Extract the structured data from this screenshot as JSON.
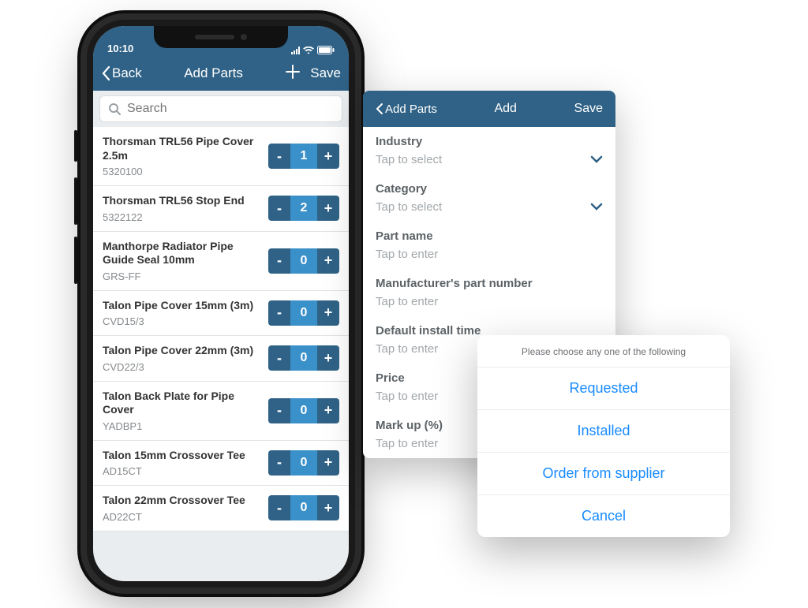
{
  "phone": {
    "status": {
      "time": "10:10"
    },
    "nav": {
      "back": "Back",
      "title": "Add Parts",
      "save": "Save"
    },
    "search": {
      "placeholder": "Search"
    },
    "parts": [
      {
        "name": "Thorsman TRL56 Pipe Cover 2.5m",
        "sku": "5320100",
        "qty": 1
      },
      {
        "name": "Thorsman TRL56 Stop End",
        "sku": "5322122",
        "qty": 2
      },
      {
        "name": "Manthorpe Radiator Pipe Guide Seal 10mm",
        "sku": "GRS-FF",
        "qty": 0
      },
      {
        "name": "Talon Pipe Cover 15mm (3m)",
        "sku": "CVD15/3",
        "qty": 0
      },
      {
        "name": "Talon Pipe Cover 22mm (3m)",
        "sku": "CVD22/3",
        "qty": 0
      },
      {
        "name": "Talon Back Plate for Pipe Cover",
        "sku": "YADBP1",
        "qty": 0
      },
      {
        "name": "Talon 15mm Crossover Tee",
        "sku": "AD15CT",
        "qty": 0
      },
      {
        "name": "Talon 22mm Crossover Tee",
        "sku": "AD22CT",
        "qty": 0
      }
    ]
  },
  "panel2": {
    "nav": {
      "back": "Add Parts",
      "title": "Add",
      "save": "Save"
    },
    "fields": [
      {
        "label": "Industry",
        "placeholder": "Tap to select",
        "dropdown": true
      },
      {
        "label": "Category",
        "placeholder": "Tap to select",
        "dropdown": true
      },
      {
        "label": "Part name",
        "placeholder": "Tap to enter",
        "dropdown": false
      },
      {
        "label": "Manufacturer's part number",
        "placeholder": "Tap to enter",
        "dropdown": false
      },
      {
        "label": "Default install time",
        "placeholder": "Tap to enter",
        "dropdown": false
      },
      {
        "label": "Price",
        "placeholder": "Tap to enter",
        "dropdown": false
      },
      {
        "label": "Mark up (%)",
        "placeholder": "Tap to enter",
        "dropdown": false
      }
    ]
  },
  "sheet": {
    "header": "Please choose any one of the following",
    "options": [
      "Requested",
      "Installed",
      "Order from supplier",
      "Cancel"
    ]
  }
}
